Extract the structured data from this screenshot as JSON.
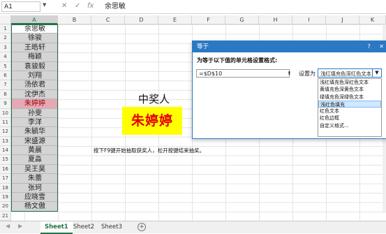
{
  "formula_bar": {
    "name_box": "A1",
    "cancel_icon": "✕",
    "enter_icon": "✓",
    "fx_icon": "fx",
    "content": "余思敏"
  },
  "columns": [
    "A",
    "B",
    "C",
    "D",
    "E",
    "F",
    "G",
    "H",
    "I",
    "J",
    "K"
  ],
  "rows": [
    "1",
    "2",
    "3",
    "4",
    "5",
    "6",
    "7",
    "8",
    "9",
    "10",
    "11",
    "12",
    "13",
    "14",
    "15",
    "16",
    "17",
    "18",
    "19",
    "20",
    "21"
  ],
  "names": [
    "余思敏",
    "徐骏",
    "王皓轩",
    "梅颖",
    "袁骏毅",
    "刘翔",
    "汤依君",
    "沈伊杰",
    "朱婷婷",
    "孙雯",
    "李洋",
    "朱毓华",
    "宋盛源",
    "黄晨",
    "夏淼",
    "吴王昊",
    "朱蕾",
    "张珂",
    "应晓雪",
    "杨文傲"
  ],
  "highlighted_index": 8,
  "winner": {
    "title": "中奖人",
    "name": "朱婷婷"
  },
  "hint": "按下F9键开始抽取获奖人，松开按键结束抽奖。",
  "dialog": {
    "title": "等于",
    "question_icon": "?",
    "close_icon": "✕",
    "label": "为等于以下值的单元格设置格式:",
    "input_value": "=$D$10",
    "set_label": "设置为",
    "selected_value": "浅红填充色深红色文本",
    "options": [
      "浅红填充色深红色文本",
      "黄填充色深黄色文本",
      "绿填充色深绿色文本",
      "浅红色填充",
      "红色文本",
      "红色边框",
      "自定义格式..."
    ],
    "selected_option_index": 3
  },
  "sheet_tabs": [
    "Sheet1",
    "Sheet2",
    "Sheet3"
  ],
  "active_tab": 0,
  "add_sheet_icon": "+"
}
